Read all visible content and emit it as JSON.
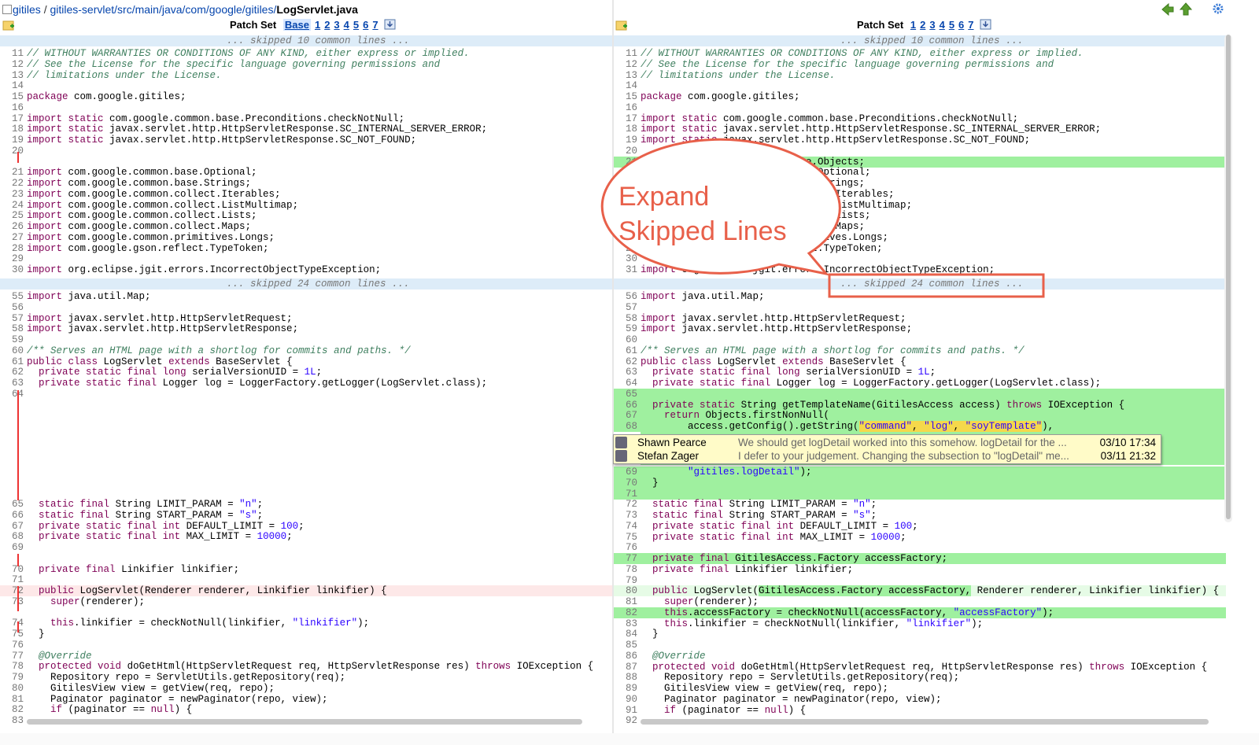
{
  "breadcrumb": {
    "repo": "gitiles",
    "path": "gitiles-servlet/src/main/java/com/google/gitiles/",
    "file": "LogServlet.java"
  },
  "left": {
    "patchset_label": "Patch Set",
    "patchsets": [
      "Base",
      "1",
      "2",
      "3",
      "4",
      "5",
      "6",
      "7"
    ],
    "selected": "Base",
    "skip_top": "... skipped 10 common lines ...",
    "skip_mid": "... skipped 24 common lines ..."
  },
  "right": {
    "patchset_label": "Patch Set",
    "patchsets": [
      "1",
      "2",
      "3",
      "4",
      "5",
      "6",
      "7"
    ],
    "selected": "7",
    "skip_top": "... skipped 10 common lines ...",
    "skip_mid": "... skipped 24 common lines ..."
  },
  "callout": {
    "line1": "Expand",
    "line2": "Skipped Lines",
    "color": "#e8604a"
  },
  "comments": [
    {
      "author": "Shawn Pearce",
      "message": "We should get logDetail worked into this somehow. logDetail for the ...",
      "date": "03/10 17:34"
    },
    {
      "author": "Stefan Zager",
      "message": "I defer to your judgement. Changing the subsection to \"logDetail\" me...",
      "date": "03/11 21:32"
    }
  ],
  "colors": {
    "insert": "#9ff09f",
    "insert_light": "#e6fbe6",
    "delete_light": "#fde8e8",
    "skip": "#ddecf8",
    "link": "#0645ad"
  },
  "left_lines": [
    {
      "n": "11",
      "t": "// WITHOUT WARRANTIES OR CONDITIONS OF ANY KIND, either express or implied."
    },
    {
      "n": "12",
      "t": "// See the License for the specific language governing permissions and"
    },
    {
      "n": "13",
      "t": "// limitations under the License."
    },
    {
      "n": "14",
      "t": ""
    },
    {
      "n": "15",
      "t": "package com.google.gitiles;"
    },
    {
      "n": "16",
      "t": ""
    },
    {
      "n": "17",
      "t": "import static com.google.common.base.Preconditions.checkNotNull;"
    },
    {
      "n": "18",
      "t": "import static javax.servlet.http.HttpServletResponse.SC_INTERNAL_SERVER_ERROR;"
    },
    {
      "n": "19",
      "t": "import static javax.servlet.http.HttpServletResponse.SC_NOT_FOUND;"
    },
    {
      "n": "20",
      "t": ""
    },
    {
      "n": "",
      "t": ""
    },
    {
      "n": "21",
      "t": "import com.google.common.base.Optional;"
    },
    {
      "n": "22",
      "t": "import com.google.common.base.Strings;"
    },
    {
      "n": "23",
      "t": "import com.google.common.collect.Iterables;"
    },
    {
      "n": "24",
      "t": "import com.google.common.collect.ListMultimap;"
    },
    {
      "n": "25",
      "t": "import com.google.common.collect.Lists;"
    },
    {
      "n": "26",
      "t": "import com.google.common.collect.Maps;"
    },
    {
      "n": "27",
      "t": "import com.google.common.primitives.Longs;"
    },
    {
      "n": "28",
      "t": "import com.google.gson.reflect.TypeToken;"
    },
    {
      "n": "29",
      "t": ""
    },
    {
      "n": "30",
      "t": "import org.eclipse.jgit.errors.IncorrectObjectTypeException;"
    }
  ],
  "left_lines2": [
    {
      "n": "55",
      "t": "import java.util.Map;"
    },
    {
      "n": "56",
      "t": ""
    },
    {
      "n": "57",
      "t": "import javax.servlet.http.HttpServletRequest;"
    },
    {
      "n": "58",
      "t": "import javax.servlet.http.HttpServletResponse;"
    },
    {
      "n": "59",
      "t": ""
    },
    {
      "n": "60",
      "t": "/** Serves an HTML page with a shortlog for commits and paths. */"
    },
    {
      "n": "61",
      "t": "public class LogServlet extends BaseServlet {"
    },
    {
      "n": "62",
      "t": "  private static final long serialVersionUID = 1L;"
    },
    {
      "n": "63",
      "t": "  private static final Logger log = LoggerFactory.getLogger(LogServlet.class);"
    },
    {
      "n": "64",
      "t": ""
    }
  ],
  "left_lines3": [
    {
      "n": "65",
      "t": "  static final String LIMIT_PARAM = \"n\";"
    },
    {
      "n": "66",
      "t": "  static final String START_PARAM = \"s\";"
    },
    {
      "n": "67",
      "t": "  private static final int DEFAULT_LIMIT = 100;"
    },
    {
      "n": "68",
      "t": "  private static final int MAX_LIMIT = 10000;"
    },
    {
      "n": "69",
      "t": ""
    },
    {
      "n": "",
      "t": ""
    },
    {
      "n": "70",
      "t": "  private final Linkifier linkifier;"
    },
    {
      "n": "71",
      "t": ""
    },
    {
      "n": "72",
      "t": "  public LogServlet(Renderer renderer, Linkifier linkifier) {"
    },
    {
      "n": "73",
      "t": "    super(renderer);"
    },
    {
      "n": "",
      "t": ""
    },
    {
      "n": "74",
      "t": "    this.linkifier = checkNotNull(linkifier, \"linkifier\");"
    },
    {
      "n": "75",
      "t": "  }"
    },
    {
      "n": "76",
      "t": ""
    },
    {
      "n": "77",
      "t": "  @Override"
    },
    {
      "n": "78",
      "t": "  protected void doGetHtml(HttpServletRequest req, HttpServletResponse res) throws IOException {"
    },
    {
      "n": "79",
      "t": "    Repository repo = ServletUtils.getRepository(req);"
    },
    {
      "n": "80",
      "t": "    GitilesView view = getView(req, repo);"
    },
    {
      "n": "81",
      "t": "    Paginator paginator = newPaginator(repo, view);"
    },
    {
      "n": "82",
      "t": "    if (paginator == null) {"
    },
    {
      "n": "83",
      "t": ""
    }
  ],
  "right_lines": [
    {
      "n": "11",
      "t": "// WITHOUT WARRANTIES OR CONDITIONS OF ANY KIND, either express or implied."
    },
    {
      "n": "12",
      "t": "// See the License for the specific language governing permissions and"
    },
    {
      "n": "13",
      "t": "// limitations under the License."
    },
    {
      "n": "14",
      "t": ""
    },
    {
      "n": "15",
      "t": "package com.google.gitiles;"
    },
    {
      "n": "16",
      "t": ""
    },
    {
      "n": "17",
      "t": "import static com.google.common.base.Preconditions.checkNotNull;"
    },
    {
      "n": "18",
      "t": "import static javax.servlet.http.HttpServletResponse.SC_INTERNAL_SERVER_ERROR;"
    },
    {
      "n": "19",
      "t": "import static javax.servlet.http.HttpServletResponse.SC_NOT_FOUND;"
    },
    {
      "n": "20",
      "t": ""
    },
    {
      "n": "21",
      "t": "import com.google.common.base.Objects;"
    },
    {
      "n": "22",
      "t": "import com.google.common.base.Optional;"
    },
    {
      "n": "23",
      "t": "import com.google.common.base.Strings;"
    },
    {
      "n": "24",
      "t": "import com.google.common.collect.Iterables;"
    },
    {
      "n": "25",
      "t": "import com.google.common.collect.ListMultimap;"
    },
    {
      "n": "26",
      "t": "import com.google.common.collect.Lists;"
    },
    {
      "n": "27",
      "t": "import com.google.common.collect.Maps;"
    },
    {
      "n": "28",
      "t": "import com.google.common.primitives.Longs;"
    },
    {
      "n": "29",
      "t": "import com.google.gson.reflect.TypeToken;"
    },
    {
      "n": "30",
      "t": ""
    },
    {
      "n": "31",
      "t": "import org.eclipse.jgit.errors.IncorrectObjectTypeException;"
    }
  ],
  "right_lines2": [
    {
      "n": "56",
      "t": "import java.util.Map;"
    },
    {
      "n": "57",
      "t": ""
    },
    {
      "n": "58",
      "t": "import javax.servlet.http.HttpServletRequest;"
    },
    {
      "n": "59",
      "t": "import javax.servlet.http.HttpServletResponse;"
    },
    {
      "n": "60",
      "t": ""
    },
    {
      "n": "61",
      "t": "/** Serves an HTML page with a shortlog for commits and paths. */"
    },
    {
      "n": "62",
      "t": "public class LogServlet extends BaseServlet {"
    },
    {
      "n": "63",
      "t": "  private static final long serialVersionUID = 1L;"
    },
    {
      "n": "64",
      "t": "  private static final Logger log = LoggerFactory.getLogger(LogServlet.class);"
    },
    {
      "n": "65",
      "t": ""
    },
    {
      "n": "66",
      "t": "  private static String getTemplateName(GitilesAccess access) throws IOException {"
    },
    {
      "n": "67",
      "t": "    return Objects.firstNonNull("
    },
    {
      "n": "68",
      "t": "        access.getConfig().getString(\"command\", \"log\", \"soyTemplate\"),"
    }
  ],
  "right_lines3": [
    {
      "n": "69",
      "t": "        \"gitiles.logDetail\");"
    },
    {
      "n": "70",
      "t": "  }"
    },
    {
      "n": "71",
      "t": ""
    },
    {
      "n": "72",
      "t": "  static final String LIMIT_PARAM = \"n\";"
    },
    {
      "n": "73",
      "t": "  static final String START_PARAM = \"s\";"
    },
    {
      "n": "74",
      "t": "  private static final int DEFAULT_LIMIT = 100;"
    },
    {
      "n": "75",
      "t": "  private static final int MAX_LIMIT = 10000;"
    },
    {
      "n": "76",
      "t": ""
    },
    {
      "n": "77",
      "t": "  private final GitilesAccess.Factory accessFactory;"
    },
    {
      "n": "78",
      "t": "  private final Linkifier linkifier;"
    },
    {
      "n": "79",
      "t": ""
    },
    {
      "n": "80",
      "t": "  public LogServlet(GitilesAccess.Factory accessFactory, Renderer renderer, Linkifier linkifier) {"
    },
    {
      "n": "81",
      "t": "    super(renderer);"
    },
    {
      "n": "82",
      "t": "    this.accessFactory = checkNotNull(accessFactory, \"accessFactory\");"
    },
    {
      "n": "83",
      "t": "    this.linkifier = checkNotNull(linkifier, \"linkifier\");"
    },
    {
      "n": "84",
      "t": "  }"
    },
    {
      "n": "85",
      "t": ""
    },
    {
      "n": "86",
      "t": "  @Override"
    },
    {
      "n": "87",
      "t": "  protected void doGetHtml(HttpServletRequest req, HttpServletResponse res) throws IOException {"
    },
    {
      "n": "88",
      "t": "    Repository repo = ServletUtils.getRepository(req);"
    },
    {
      "n": "89",
      "t": "    GitilesView view = getView(req, repo);"
    },
    {
      "n": "90",
      "t": "    Paginator paginator = newPaginator(repo, view);"
    },
    {
      "n": "91",
      "t": "    if (paginator == null) {"
    },
    {
      "n": "92",
      "t": ""
    }
  ]
}
